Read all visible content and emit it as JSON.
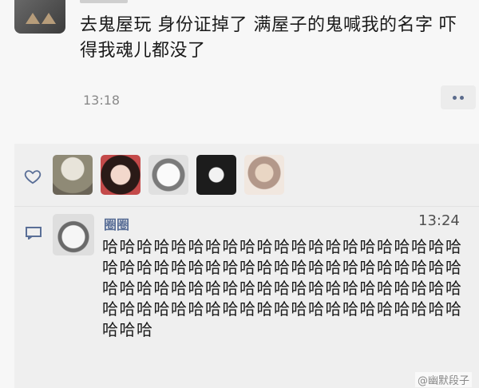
{
  "post": {
    "text": "去鬼屋玩 身份证掉了 满屋子的鬼喊我的名字 吓得我魂儿都没了",
    "time": "13:18"
  },
  "social": {
    "likers": [
      "liker-1",
      "liker-2",
      "liker-3",
      "liker-4",
      "liker-5"
    ],
    "comment": {
      "author": "圈圈",
      "time": "13:24",
      "text": "哈哈哈哈哈哈哈哈哈哈哈哈哈哈哈哈哈哈哈哈哈哈哈哈哈哈哈哈哈哈哈哈哈哈哈哈哈哈哈哈哈哈哈哈哈哈哈哈哈哈哈哈哈哈哈哈哈哈哈哈哈哈哈哈哈哈哈哈哈哈哈哈哈哈哈哈哈哈哈哈哈哈哈哈哈哈哈"
    }
  },
  "watermark": "@幽默段子",
  "colors": {
    "accent": "#5a6f97",
    "background": "#f7f7f7",
    "social_bg": "#efefef"
  }
}
